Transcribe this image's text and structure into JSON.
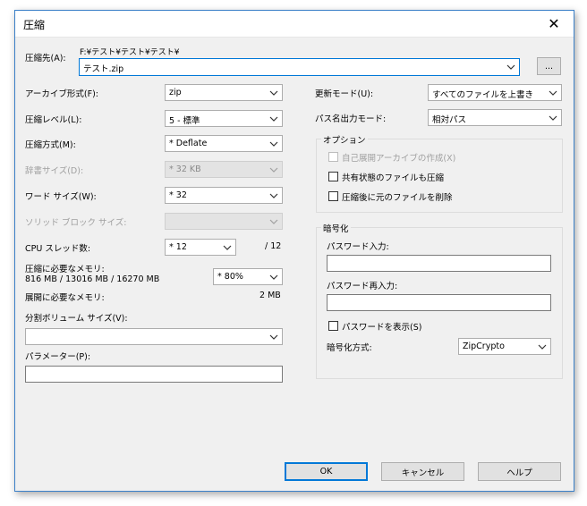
{
  "window": {
    "title": "圧縮",
    "close_glyph": "✕"
  },
  "destination": {
    "label": "圧縮先(A):",
    "path_text": "F:¥テスト¥テスト¥テスト¥",
    "value": "テスト.zip",
    "browse_label": "..."
  },
  "left": {
    "archive_format": {
      "label": "アーカイブ形式(F):",
      "value": "zip"
    },
    "compression_level": {
      "label": "圧縮レベル(L):",
      "value": "5 - 標準"
    },
    "compression_method": {
      "label": "圧縮方式(M):",
      "value": "* Deflate"
    },
    "dictionary_size": {
      "label": "辞書サイズ(D):",
      "value": "* 32 KB"
    },
    "word_size": {
      "label": "ワード サイズ(W):",
      "value": "* 32"
    },
    "solid_block_size": {
      "label": "ソリッド ブロック サイズ:",
      "value": ""
    },
    "cpu_threads": {
      "label": "CPU スレッド数:",
      "value": "* 12",
      "max_text": "/ 12"
    },
    "compress_memory": {
      "label": "圧縮に必要なメモリ:",
      "detail": "816 MB / 13016 MB / 16270 MB",
      "value": "* 80%"
    },
    "decompress_memory": {
      "label": "展開に必要なメモリ:",
      "value": "2 MB"
    },
    "split_volume": {
      "label": "分割ボリューム サイズ(V):",
      "value": ""
    },
    "parameters": {
      "label": "パラメーター(P):",
      "value": ""
    }
  },
  "right": {
    "update_mode": {
      "label": "更新モード(U):",
      "value": "すべてのファイルを上書き"
    },
    "path_mode": {
      "label": "パス名出力モード:",
      "value": "相対パス"
    },
    "options": {
      "title": "オプション",
      "sfx": {
        "label": "自己展開アーカイブの作成(X)",
        "checked": false,
        "disabled": true
      },
      "shared": {
        "label": "共有状態のファイルも圧縮",
        "checked": false
      },
      "delete_after": {
        "label": "圧縮後に元のファイルを削除",
        "checked": false
      }
    },
    "encryption": {
      "title": "暗号化",
      "password_label": "パスワード入力:",
      "password_value": "",
      "reenter_label": "パスワード再入力:",
      "reenter_value": "",
      "show_password_label": "パスワードを表示(S)",
      "method_label": "暗号化方式:",
      "method_value": "ZipCrypto"
    }
  },
  "buttons": {
    "ok": "OK",
    "cancel": "キャンセル",
    "help": "ヘルプ"
  },
  "colors": {
    "accent": "#0078d7",
    "title_border": "#3b80c8",
    "dialog_bg": "#f0f0f0"
  }
}
